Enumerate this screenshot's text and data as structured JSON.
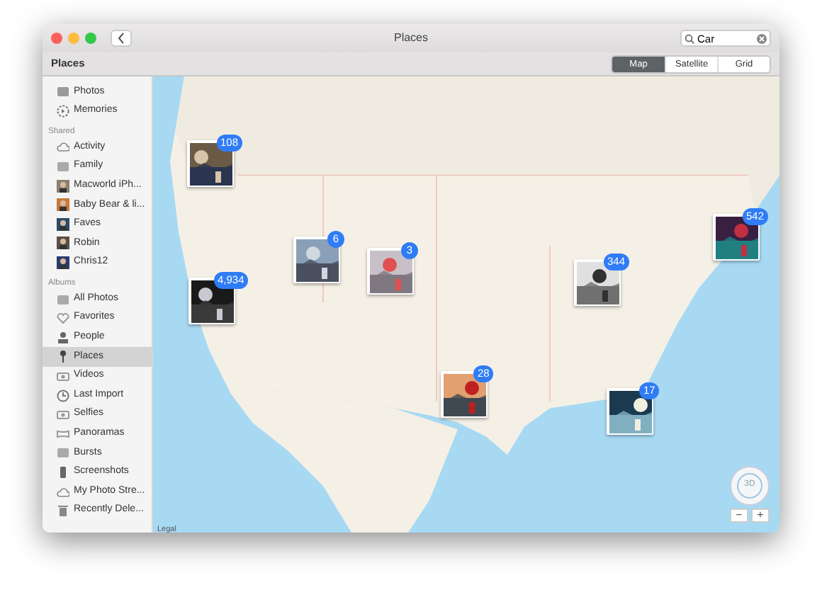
{
  "window": {
    "title": "Places"
  },
  "search": {
    "value": "Car"
  },
  "header": {
    "title": "Places",
    "views": [
      {
        "label": "Map",
        "selected": true
      },
      {
        "label": "Satellite",
        "selected": false
      },
      {
        "label": "Grid",
        "selected": false
      }
    ]
  },
  "sidebar": {
    "sections": [
      {
        "items": [
          {
            "label": "Photos",
            "selected": false
          },
          {
            "label": "Memories",
            "selected": false
          }
        ]
      },
      {
        "heading": "Shared",
        "items": [
          {
            "label": "Activity",
            "selected": false
          },
          {
            "label": "Family",
            "selected": false
          },
          {
            "label": "Macworld iPh...",
            "selected": false
          },
          {
            "label": "Baby Bear & li...",
            "selected": false
          },
          {
            "label": "Faves",
            "selected": false
          },
          {
            "label": "Robin",
            "selected": false
          },
          {
            "label": "Chris12",
            "selected": false
          }
        ]
      },
      {
        "heading": "Albums",
        "items": [
          {
            "label": "All Photos",
            "selected": false
          },
          {
            "label": "Favorites",
            "selected": false
          },
          {
            "label": "People",
            "selected": false
          },
          {
            "label": "Places",
            "selected": true
          },
          {
            "label": "Videos",
            "selected": false
          },
          {
            "label": "Last Import",
            "selected": false
          },
          {
            "label": "Selfies",
            "selected": false
          },
          {
            "label": "Panoramas",
            "selected": false
          },
          {
            "label": "Bursts",
            "selected": false
          },
          {
            "label": "Screenshots",
            "selected": false
          },
          {
            "label": "My Photo Stre...",
            "selected": false
          },
          {
            "label": "Recently Dele...",
            "selected": false
          }
        ]
      }
    ]
  },
  "map": {
    "pins": [
      {
        "count": "108"
      },
      {
        "count": "4,934"
      },
      {
        "count": "6"
      },
      {
        "count": "3"
      },
      {
        "count": "344"
      },
      {
        "count": "542"
      },
      {
        "count": "28"
      },
      {
        "count": "17"
      }
    ],
    "compass_label": "3D",
    "zoom_out": "−",
    "zoom_in": "+",
    "legal_link": "Legal"
  }
}
